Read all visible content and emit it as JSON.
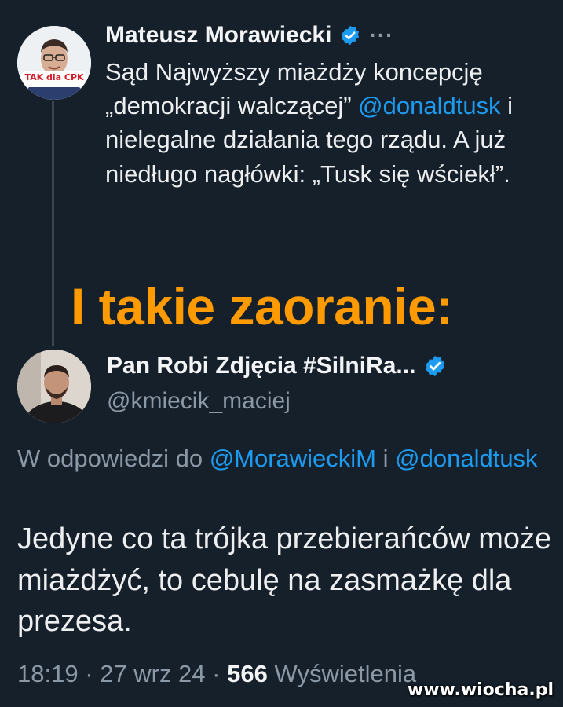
{
  "original_tweet": {
    "author_name": "Mateusz Morawiecki",
    "more_icon": "···",
    "avatar_badge_text": "TAK dla CPK",
    "text_before_mention": "Sąd Najwyższy miażdży koncepcję „demokracji walczącej” ",
    "mention": "@donaldtusk",
    "text_after_mention": " i nielegalne działania tego rządu. A już niedługo nagłówki: „Tusk się wściekł”."
  },
  "overlay_caption": "I takie zaoranie:",
  "reply_tweet": {
    "author_name": "Pan Robi Zdjęcia #SilniRa...",
    "handle": "@kmiecik_maciej",
    "reply_prefix": "W odpowiedzi do ",
    "reply_mention_1": "@MorawieckiM",
    "reply_connector": " i ",
    "reply_mention_2": "@donaldtusk",
    "text": "Jedyne co ta trójka przebierańców może miażdżyć, to cebulę na zasmażkę dla prezesa.",
    "time": "18:19",
    "separator": " · ",
    "date": "27 wrz 24",
    "views_count": "566",
    "views_label": " Wyświetlenia"
  },
  "watermark": "www.wiocha.pl",
  "colors": {
    "background": "#15202b",
    "link": "#1d9bf0",
    "overlay": "#ff9a00",
    "secondary_text": "#8b98a5"
  }
}
